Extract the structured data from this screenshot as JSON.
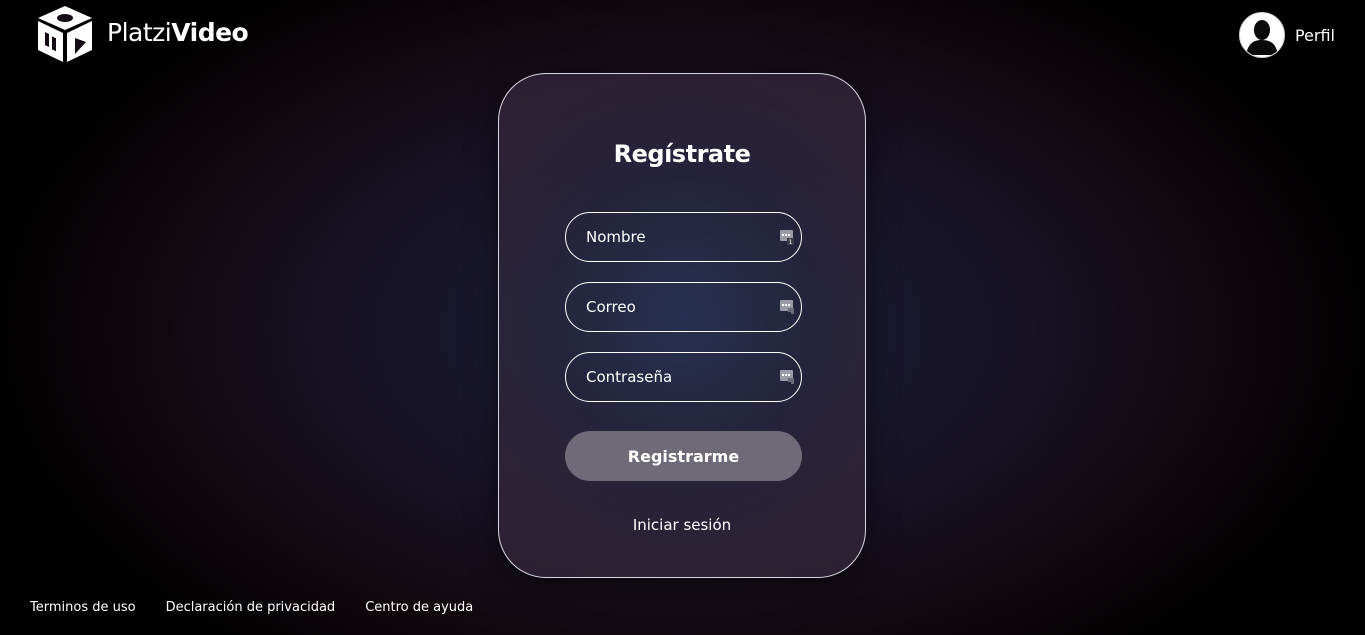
{
  "header": {
    "logo_light": "Platzi",
    "logo_bold": "Video",
    "profile_label": "Perfil"
  },
  "card": {
    "title": "Regístrate",
    "fields": {
      "name_placeholder": "Nombre",
      "email_placeholder": "Correo",
      "password_placeholder": "Contraseña"
    },
    "submit_label": "Registrarme",
    "login_link": "Iniciar sesión"
  },
  "footer": {
    "links": [
      "Terminos de uso",
      "Declaración de privacidad",
      "Centro de ayuda"
    ]
  },
  "icons": {
    "logo": "dice-logo-icon",
    "avatar": "user-avatar-icon",
    "field_autofill": "password-manager-key-icon"
  },
  "colors": {
    "button": "#6e6a78",
    "text": "#ffffff",
    "card_border": "#d8d8e4"
  }
}
